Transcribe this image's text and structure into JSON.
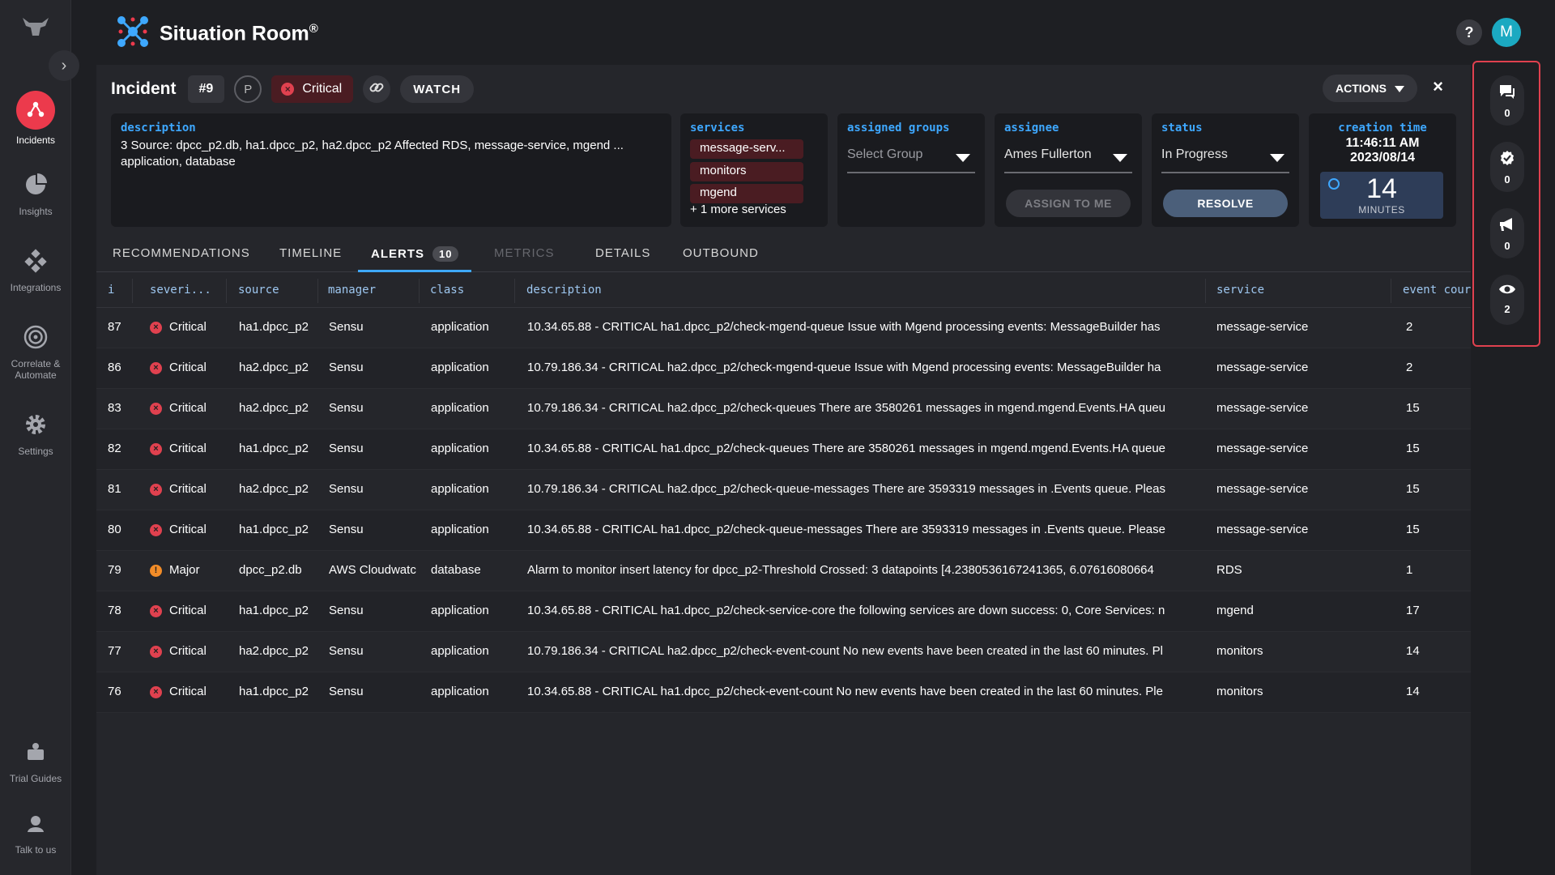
{
  "app": {
    "title": "Situation Room",
    "title_mark": "®",
    "help_label": "?",
    "user_initial": "M"
  },
  "nav": {
    "items": [
      {
        "label": "Incidents",
        "icon": "incidents-icon",
        "active": true
      },
      {
        "label": "Insights",
        "icon": "pie-chart-icon",
        "active": false
      },
      {
        "label": "Integrations",
        "icon": "integrations-icon",
        "active": false
      },
      {
        "label": "Correlate & Automate",
        "icon": "target-icon",
        "active": false
      },
      {
        "label": "Settings",
        "icon": "gear-icon",
        "active": false
      },
      {
        "label": "Trial Guides",
        "icon": "book-icon",
        "active": false
      },
      {
        "label": "Talk to us",
        "icon": "support-icon",
        "active": false
      }
    ]
  },
  "incident": {
    "label": "Incident",
    "number": "#9",
    "priority": "P",
    "severity": "Critical",
    "watch_label": "WATCH",
    "actions_label": "ACTIONS",
    "close_label": "×"
  },
  "cards": {
    "description": {
      "label": "description",
      "text": "3 Source: dpcc_p2.db, ha1.dpcc_p2, ha2.dpcc_p2 Affected RDS, message-service, mgend ... application, database"
    },
    "services": {
      "label": "services",
      "items": [
        "message-serv...",
        "monitors",
        "mgend"
      ],
      "more": "+ 1 more services"
    },
    "assigned_groups": {
      "label": "assigned groups",
      "placeholder": "Select Group"
    },
    "assignee": {
      "label": "assignee",
      "value": "Ames Fullerton",
      "button": "ASSIGN TO ME"
    },
    "status": {
      "label": "status",
      "value": "In Progress",
      "button": "RESOLVE"
    },
    "creation_time": {
      "label": "creation time",
      "time": "11:46:11 AM",
      "date": "2023/08/14",
      "elapsed": "14",
      "unit": "MINUTES"
    }
  },
  "tabs": [
    {
      "label": "RECOMMENDATIONS",
      "state": "normal"
    },
    {
      "label": "TIMELINE",
      "state": "normal"
    },
    {
      "label": "ALERTS",
      "state": "active",
      "badge": "10"
    },
    {
      "label": "METRICS",
      "state": "disabled"
    },
    {
      "label": "DETAILS",
      "state": "normal"
    },
    {
      "label": "OUTBOUND",
      "state": "normal"
    }
  ],
  "alerts": {
    "columns": [
      "i",
      "severi...",
      "source",
      "manager",
      "class",
      "description",
      "service",
      "event cour"
    ],
    "rows": [
      {
        "id": "87",
        "severity": "Critical",
        "source": "ha1.dpcc_p2",
        "manager": "Sensu",
        "class": "application",
        "description": "10.34.65.88 - CRITICAL ha1.dpcc_p2/check-mgend-queue Issue with Mgend processing events: MessageBuilder has",
        "service": "message-service",
        "count": "2"
      },
      {
        "id": "86",
        "severity": "Critical",
        "source": "ha2.dpcc_p2",
        "manager": "Sensu",
        "class": "application",
        "description": "10.79.186.34 - CRITICAL ha2.dpcc_p2/check-mgend-queue Issue with Mgend processing events: MessageBuilder ha",
        "service": "message-service",
        "count": "2"
      },
      {
        "id": "83",
        "severity": "Critical",
        "source": "ha2.dpcc_p2",
        "manager": "Sensu",
        "class": "application",
        "description": "10.79.186.34 - CRITICAL ha2.dpcc_p2/check-queues There are 3580261 messages in mgend.mgend.Events.HA queu",
        "service": "message-service",
        "count": "15"
      },
      {
        "id": "82",
        "severity": "Critical",
        "source": "ha1.dpcc_p2",
        "manager": "Sensu",
        "class": "application",
        "description": "10.34.65.88 - CRITICAL ha1.dpcc_p2/check-queues There are 3580261 messages in mgend.mgend.Events.HA queue",
        "service": "message-service",
        "count": "15"
      },
      {
        "id": "81",
        "severity": "Critical",
        "source": "ha2.dpcc_p2",
        "manager": "Sensu",
        "class": "application",
        "description": "10.79.186.34 - CRITICAL ha2.dpcc_p2/check-queue-messages There are 3593319 messages in .Events queue. Pleas",
        "service": "message-service",
        "count": "15"
      },
      {
        "id": "80",
        "severity": "Critical",
        "source": "ha1.dpcc_p2",
        "manager": "Sensu",
        "class": "application",
        "description": "10.34.65.88 - CRITICAL ha1.dpcc_p2/check-queue-messages There are 3593319 messages in .Events queue. Please",
        "service": "message-service",
        "count": "15"
      },
      {
        "id": "79",
        "severity": "Major",
        "source": "dpcc_p2.db",
        "manager": "AWS Cloudwatc",
        "class": "database",
        "description": "Alarm to monitor insert latency for dpcc_p2-Threshold Crossed: 3 datapoints [4.2380536167241365, 6.07616080664",
        "service": "RDS",
        "count": "1"
      },
      {
        "id": "78",
        "severity": "Critical",
        "source": "ha1.dpcc_p2",
        "manager": "Sensu",
        "class": "application",
        "description": "10.34.65.88 - CRITICAL ha1.dpcc_p2/check-service-core the following services are down success: 0, Core Services: n",
        "service": "mgend",
        "count": "17"
      },
      {
        "id": "77",
        "severity": "Critical",
        "source": "ha2.dpcc_p2",
        "manager": "Sensu",
        "class": "application",
        "description": "10.79.186.34 - CRITICAL ha2.dpcc_p2/check-event-count No new events have been created in the last 60 minutes. Pl",
        "service": "monitors",
        "count": "14"
      },
      {
        "id": "76",
        "severity": "Critical",
        "source": "ha1.dpcc_p2",
        "manager": "Sensu",
        "class": "application",
        "description": "10.34.65.88 - CRITICAL ha1.dpcc_p2/check-event-count No new events have been created in the last 60 minutes. Ple",
        "service": "monitors",
        "count": "14"
      }
    ]
  },
  "rail": {
    "items": [
      {
        "icon": "chat-icon",
        "count": "0"
      },
      {
        "icon": "check-shield-icon",
        "count": "0"
      },
      {
        "icon": "megaphone-icon",
        "count": "0"
      },
      {
        "icon": "eye-icon",
        "count": "2"
      }
    ]
  },
  "colors": {
    "critical": "#e0414f",
    "major": "#f28c28",
    "accent": "#3ea8ff",
    "highlight_border": "#e0414f"
  }
}
